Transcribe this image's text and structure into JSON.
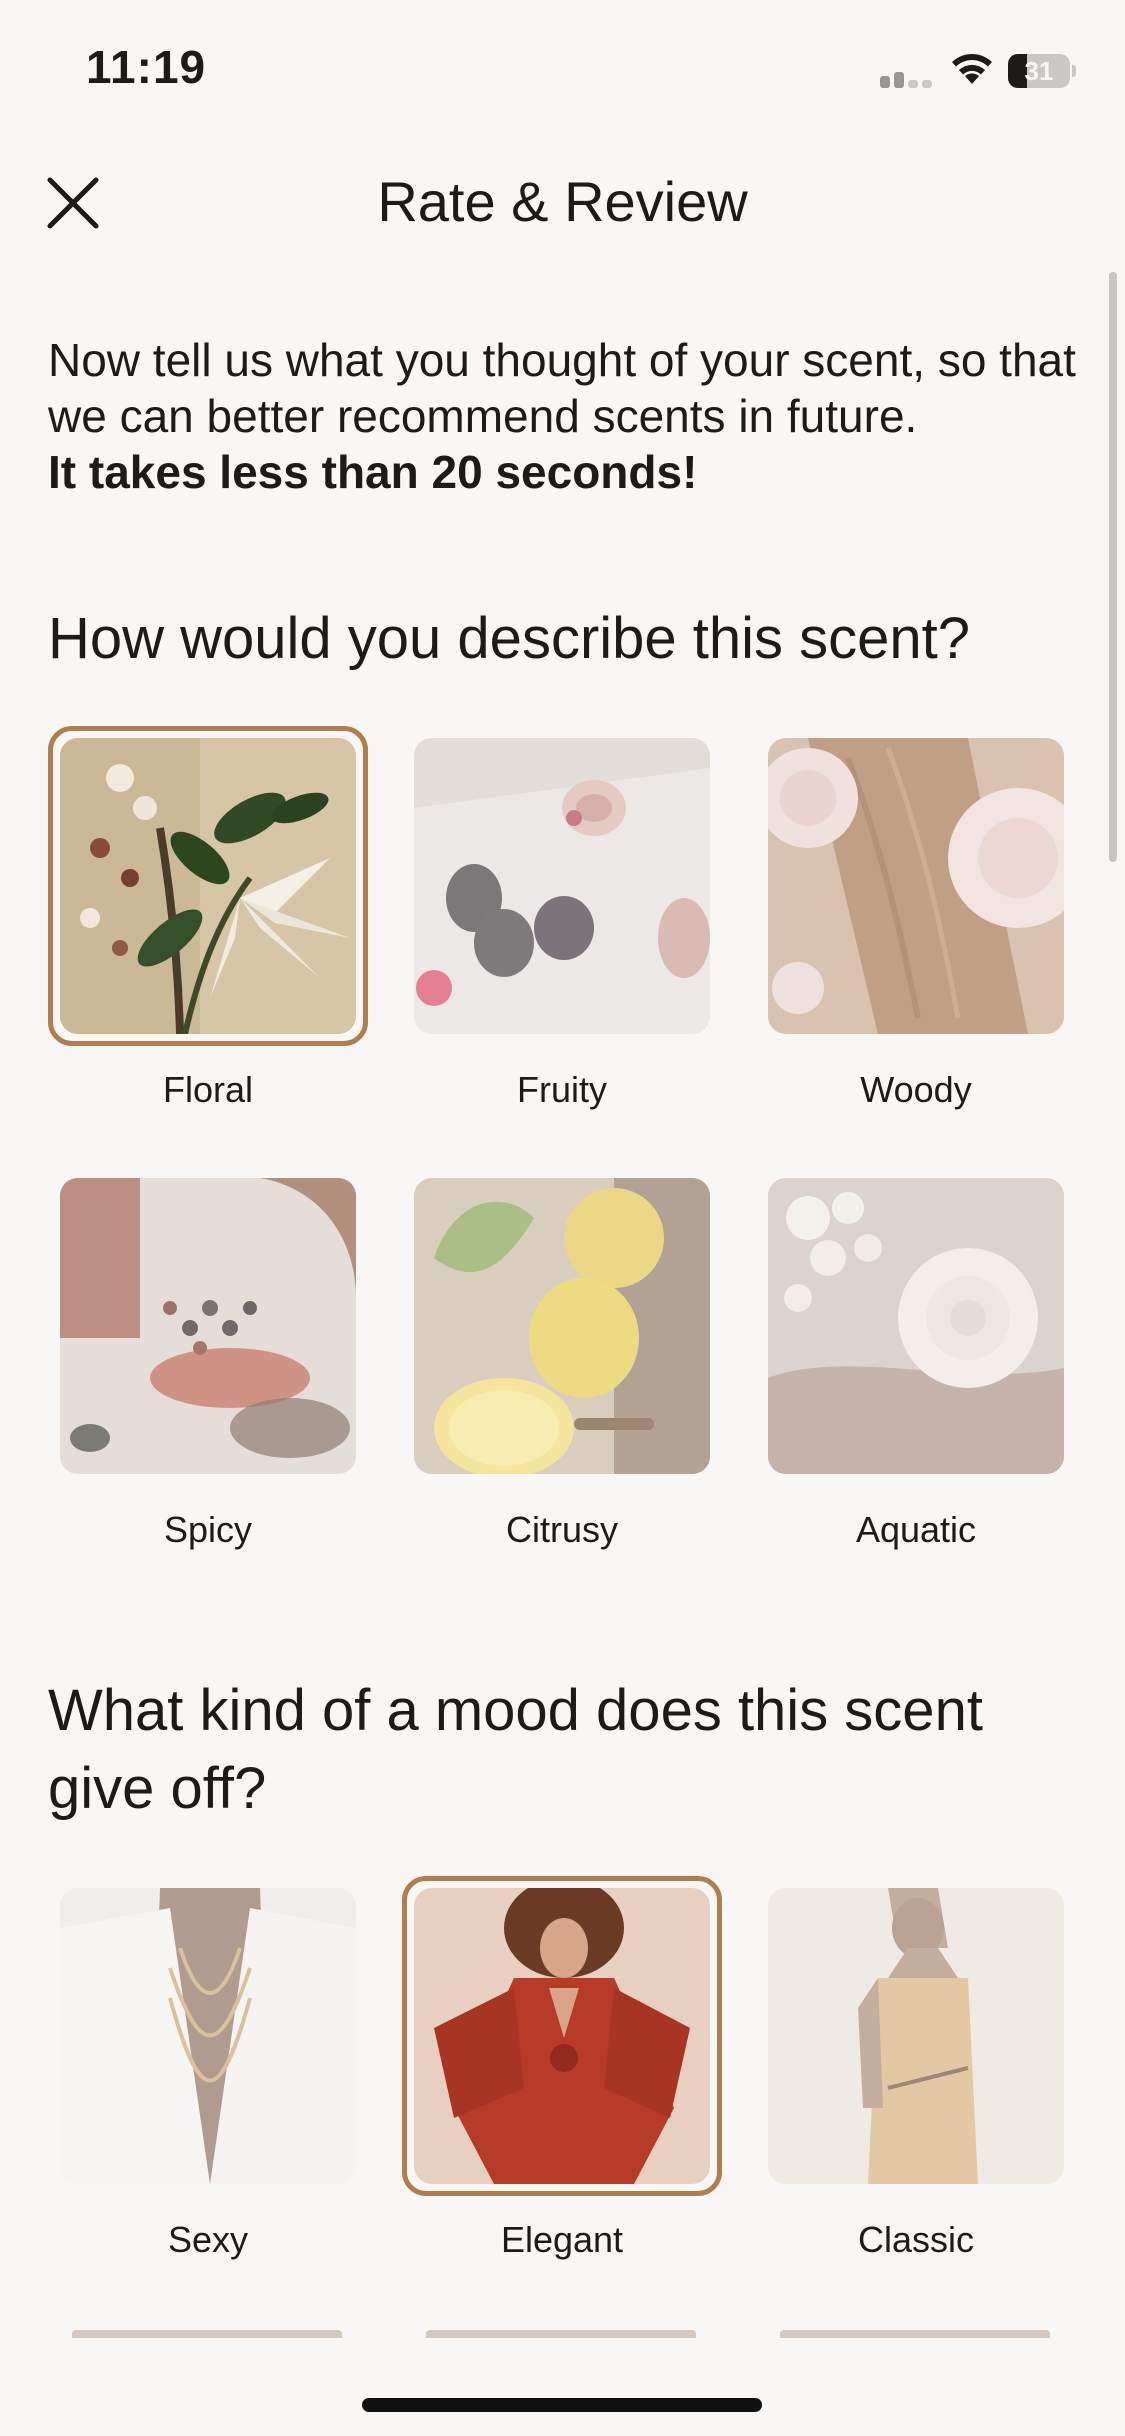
{
  "status_bar": {
    "time": "11:19",
    "battery_percent": "31"
  },
  "nav": {
    "title": "Rate & Review",
    "close_icon": "close-icon"
  },
  "intro": {
    "text": "Now tell us what you thought of your scent, so that we can better recommend scents in future.",
    "bold_text": "It takes less than 20 seconds!"
  },
  "describe": {
    "title": "How would you describe this scent?",
    "options": [
      {
        "label": "Floral",
        "selected": true
      },
      {
        "label": "Fruity",
        "selected": false
      },
      {
        "label": "Woody",
        "selected": false
      },
      {
        "label": "Spicy",
        "selected": false
      },
      {
        "label": "Citrusy",
        "selected": false
      },
      {
        "label": "Aquatic",
        "selected": false
      }
    ]
  },
  "mood": {
    "title": "What kind of a mood does this scent give off?",
    "options": [
      {
        "label": "Sexy",
        "selected": false
      },
      {
        "label": "Elegant",
        "selected": true
      },
      {
        "label": "Classic",
        "selected": false
      }
    ]
  },
  "colors": {
    "accent": "#b07e4d",
    "background": "#f8f7f6"
  }
}
